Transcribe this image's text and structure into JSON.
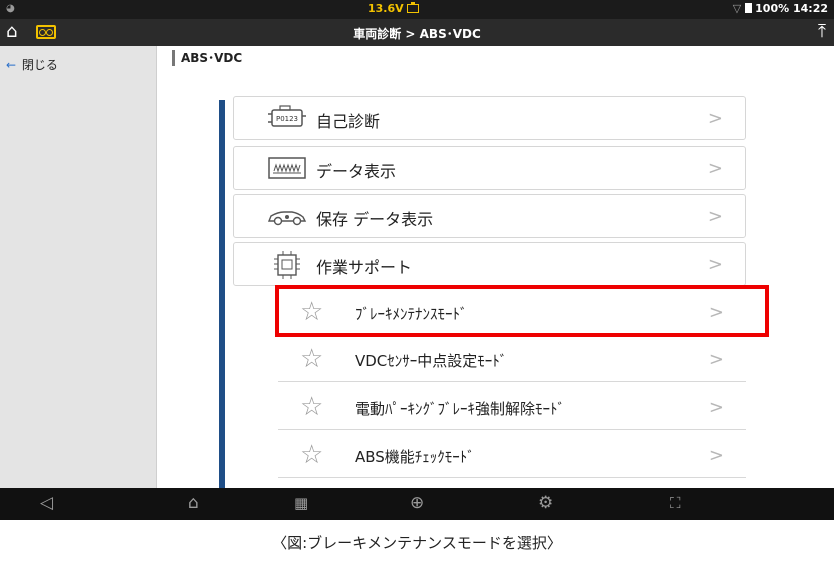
{
  "status_bar": {
    "wifi_icon": "wifi-icon",
    "voltage": "13.6V",
    "battery_percent": "100%",
    "time": "14:22"
  },
  "title_bar": {
    "title": "車両診断 > ABS･VDC",
    "home_icon": "home-icon",
    "record_icon": "cassette-icon",
    "upload_icon": "upload-icon"
  },
  "sidebar": {
    "close_label": "閉じる"
  },
  "main": {
    "breadcrumb": "ABS･VDC",
    "menu_items": [
      {
        "label": "自己診断",
        "icon": "engine-dtc-icon",
        "icon_text": "P0123"
      },
      {
        "label": "データ表示",
        "icon": "waveform-icon"
      },
      {
        "label": "保存 データ表示",
        "icon": "car-icon"
      },
      {
        "label": "作業サポート",
        "icon": "chip-icon"
      }
    ],
    "sub_items": [
      {
        "label": "ﾌﾞﾚｰｷﾒﾝﾃﾅﾝｽﾓｰﾄﾞ",
        "highlighted": true
      },
      {
        "label": "VDCｾﾝｻｰ中点設定ﾓｰﾄﾞ",
        "highlighted": false
      },
      {
        "label": "電動ﾊﾟｰｷﾝｸﾞﾌﾞﾚｰｷ強制解除ﾓｰﾄﾞ",
        "highlighted": false
      },
      {
        "label": "ABS機能ﾁｪｯｸﾓｰﾄﾞ",
        "highlighted": false
      }
    ]
  },
  "nav_bar": {
    "items": [
      "back-icon",
      "home-icon",
      "apps-grid-icon",
      "globe-icon",
      "gear-icon",
      "fullscreen-icon"
    ]
  },
  "colors": {
    "highlight": "#ee0000",
    "accent_bar": "#1f4e87",
    "voltage": "#f2c200"
  },
  "caption": "〈図:ブレーキメンテナンスモードを選択〉"
}
